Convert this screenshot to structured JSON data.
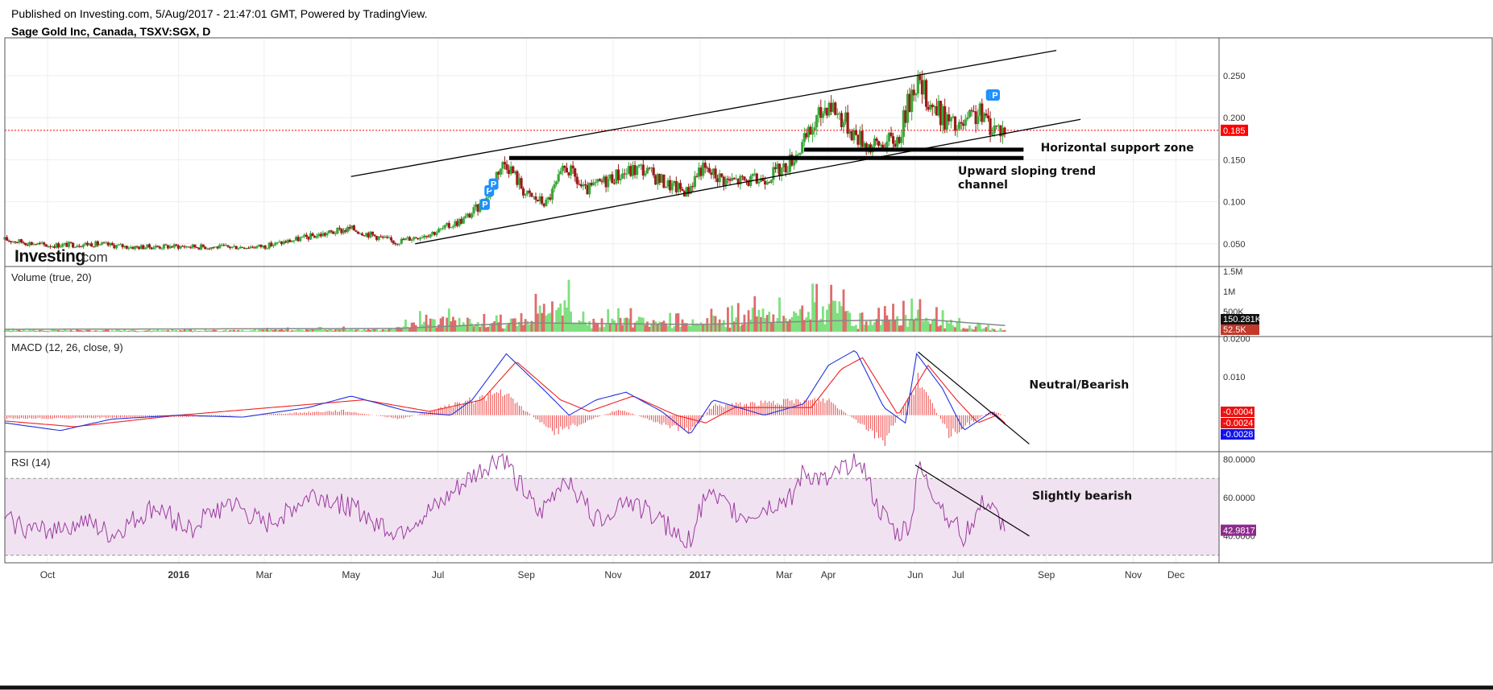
{
  "header": {
    "published": "Published on Investing.com, 5/Aug/2017 - 21:47:01 GMT, Powered by TradingView.",
    "instrument": "Sage Gold Inc, Canada, TSXV:SGX, D"
  },
  "logo": {
    "main": "Investing",
    "suffix": ".com"
  },
  "colors": {
    "up": "#3aa83a",
    "down": "#9c1a1a",
    "vol_up": "#7fe07f",
    "vol_down": "#e06b6b",
    "vol_ma": "#888888",
    "macd": "#2233dd",
    "signal": "#ee2222",
    "hist": "#ee4444",
    "rsi": "#9b3aa0",
    "rsi_band": "#f1e2f1",
    "last_price": "#ff0000",
    "badge": "#1e90ff"
  },
  "chart_data": [
    {
      "type": "candlestick",
      "title": "Sage Gold Inc, Canada, TSXV:SGX, D",
      "x_ticks": [
        {
          "label": "Oct",
          "date": "2015-10-01",
          "bold": false
        },
        {
          "label": "2016",
          "date": "2016-01-01",
          "bold": true
        },
        {
          "label": "Mar",
          "date": "2016-03-01",
          "bold": false
        },
        {
          "label": "May",
          "date": "2016-05-01",
          "bold": false
        },
        {
          "label": "Jul",
          "date": "2016-07-01",
          "bold": false
        },
        {
          "label": "Sep",
          "date": "2016-09-01",
          "bold": false
        },
        {
          "label": "Nov",
          "date": "2016-11-01",
          "bold": false
        },
        {
          "label": "2017",
          "date": "2017-01-01",
          "bold": true
        },
        {
          "label": "Mar",
          "date": "2017-03-01",
          "bold": false
        },
        {
          "label": "Apr",
          "date": "2017-04-01",
          "bold": false
        },
        {
          "label": "Jun",
          "date": "2017-06-01",
          "bold": false
        },
        {
          "label": "Jul",
          "date": "2017-07-01",
          "bold": false
        },
        {
          "label": "Sep",
          "date": "2017-09-01",
          "bold": false
        },
        {
          "label": "Nov",
          "date": "2017-11-01",
          "bold": false
        },
        {
          "label": "Dec",
          "date": "2017-12-01",
          "bold": false
        }
      ],
      "ylim": [
        0.023,
        0.295
      ],
      "y_ticks": [
        "0.050",
        "0.100",
        "0.150",
        "0.200",
        "0.250"
      ],
      "last_price": {
        "value": 0.185,
        "label": "0.185"
      },
      "series": [
        {
          "date": "2015-09-01",
          "close": 0.055
        },
        {
          "date": "2015-10-01",
          "close": 0.048
        },
        {
          "date": "2015-11-01",
          "close": 0.05
        },
        {
          "date": "2015-12-01",
          "close": 0.046
        },
        {
          "date": "2016-01-01",
          "close": 0.047
        },
        {
          "date": "2016-02-01",
          "close": 0.046
        },
        {
          "date": "2016-03-01",
          "close": 0.047
        },
        {
          "date": "2016-04-01",
          "close": 0.058
        },
        {
          "date": "2016-05-01",
          "close": 0.068
        },
        {
          "date": "2016-06-01",
          "close": 0.052
        },
        {
          "date": "2016-07-01",
          "close": 0.065
        },
        {
          "date": "2016-07-20",
          "close": 0.08
        },
        {
          "date": "2016-08-03",
          "close": 0.1
        },
        {
          "date": "2016-08-12",
          "close": 0.138
        },
        {
          "date": "2016-08-18",
          "close": 0.148
        },
        {
          "date": "2016-09-01",
          "close": 0.108
        },
        {
          "date": "2016-09-15",
          "close": 0.098
        },
        {
          "date": "2016-09-29",
          "close": 0.142
        },
        {
          "date": "2016-10-12",
          "close": 0.112
        },
        {
          "date": "2016-11-01",
          "close": 0.13
        },
        {
          "date": "2016-11-20",
          "close": 0.14
        },
        {
          "date": "2016-12-10",
          "close": 0.12
        },
        {
          "date": "2016-12-23",
          "close": 0.112
        },
        {
          "date": "2017-01-01",
          "close": 0.14
        },
        {
          "date": "2017-01-20",
          "close": 0.125
        },
        {
          "date": "2017-02-10",
          "close": 0.125
        },
        {
          "date": "2017-03-01",
          "close": 0.14
        },
        {
          "date": "2017-03-15",
          "close": 0.17
        },
        {
          "date": "2017-04-01",
          "close": 0.22
        },
        {
          "date": "2017-04-20",
          "close": 0.18
        },
        {
          "date": "2017-05-01",
          "close": 0.165
        },
        {
          "date": "2017-05-20",
          "close": 0.175
        },
        {
          "date": "2017-06-01",
          "close": 0.245
        },
        {
          "date": "2017-06-15",
          "close": 0.21
        },
        {
          "date": "2017-07-01",
          "close": 0.185
        },
        {
          "date": "2017-07-15",
          "close": 0.205
        },
        {
          "date": "2017-07-25",
          "close": 0.19
        },
        {
          "date": "2017-08-04",
          "close": 0.185
        }
      ],
      "badges": [
        {
          "label": "P",
          "date": "2016-08-06",
          "y": 0.113
        },
        {
          "label": "P",
          "date": "2016-08-09",
          "y": 0.121
        },
        {
          "label": "P",
          "date": "2016-08-03",
          "y": 0.097
        },
        {
          "label": "I",
          "date": "2017-07-24",
          "y": 0.227
        },
        {
          "label": "P",
          "date": "2017-07-27",
          "y": 0.227
        }
      ],
      "drawings": [
        {
          "kind": "line",
          "width": 1.3,
          "from": {
            "date": "2016-05-01",
            "y": 0.13
          },
          "to": {
            "date": "2017-09-08",
            "y": 0.28
          }
        },
        {
          "kind": "line",
          "width": 1.3,
          "from": {
            "date": "2016-06-15",
            "y": 0.05
          },
          "to": {
            "date": "2017-09-25",
            "y": 0.198
          }
        },
        {
          "kind": "line",
          "width": 5,
          "from": {
            "date": "2016-08-20",
            "y": 0.152
          },
          "to": {
            "date": "2017-08-16",
            "y": 0.152
          }
        },
        {
          "kind": "line",
          "width": 5,
          "from": {
            "date": "2017-03-15",
            "y": 0.162
          },
          "to": {
            "date": "2017-08-16",
            "y": 0.162
          }
        }
      ],
      "annotations": [
        {
          "lines": [
            "Horizontal support zone"
          ],
          "date": "2017-08-28",
          "y": 0.16
        },
        {
          "lines": [
            "Upward sloping trend",
            "channel"
          ],
          "date": "2017-07-01",
          "y": 0.132
        }
      ]
    },
    {
      "type": "bar",
      "title": "Volume (true, 20)",
      "ylim": [
        0,
        1500000
      ],
      "y_ticks": [
        {
          "value": 1500000,
          "label": "1.5M"
        },
        {
          "value": 1000000,
          "label": "1M"
        },
        {
          "value": 500000,
          "label": "500K"
        }
      ],
      "last_values": [
        {
          "label": "150.281K",
          "value": 150281,
          "series": "ma"
        },
        {
          "label": "52.5K",
          "value": 52500,
          "series": "volume"
        }
      ],
      "series": [
        {
          "date": "2015-09-01",
          "value": 80000
        },
        {
          "date": "2016-01-01",
          "value": 60000
        },
        {
          "date": "2016-06-01",
          "value": 150000
        },
        {
          "date": "2016-06-25",
          "value": 650000
        },
        {
          "date": "2016-08-10",
          "value": 400000
        },
        {
          "date": "2016-08-18",
          "value": 450000
        },
        {
          "date": "2016-09-29",
          "value": 1450000
        },
        {
          "date": "2016-10-10",
          "value": 500000
        },
        {
          "date": "2016-11-10",
          "value": 600000
        },
        {
          "date": "2016-12-15",
          "value": 450000
        },
        {
          "date": "2017-01-01",
          "value": 550000
        },
        {
          "date": "2017-01-20",
          "value": 600000
        },
        {
          "date": "2017-02-20",
          "value": 1050000
        },
        {
          "date": "2017-03-05",
          "value": 600000
        },
        {
          "date": "2017-03-10",
          "value": 1000000
        },
        {
          "date": "2017-03-18",
          "value": 1200000
        },
        {
          "date": "2017-04-10",
          "value": 1150000
        },
        {
          "date": "2017-04-22",
          "value": 450000
        },
        {
          "date": "2017-06-01",
          "value": 850000
        },
        {
          "date": "2017-06-05",
          "value": 800000
        },
        {
          "date": "2017-07-01",
          "value": 350000
        },
        {
          "date": "2017-08-04",
          "value": 52500
        }
      ],
      "ma_series": [
        {
          "date": "2015-09-01",
          "value": 60000
        },
        {
          "date": "2016-06-01",
          "value": 80000
        },
        {
          "date": "2016-09-01",
          "value": 220000
        },
        {
          "date": "2017-01-01",
          "value": 180000
        },
        {
          "date": "2017-04-01",
          "value": 270000
        },
        {
          "date": "2017-06-10",
          "value": 300000
        },
        {
          "date": "2017-08-04",
          "value": 150281
        }
      ]
    },
    {
      "type": "line",
      "title": "MACD (12, 26, close, 9)",
      "ylim": [
        -0.0095,
        0.0205
      ],
      "y_ticks": [
        "0.0200",
        "0.010"
      ],
      "last_values": [
        {
          "label": "-0.0004",
          "value": -0.0004,
          "series": "histogram"
        },
        {
          "label": "-0.0024",
          "value": -0.0024,
          "series": "signal"
        },
        {
          "label": "-0.0028",
          "value": -0.0028,
          "series": "macd"
        }
      ],
      "macd": [
        {
          "date": "2015-09-01",
          "value": -0.002
        },
        {
          "date": "2015-10-10",
          "value": -0.004
        },
        {
          "date": "2015-11-15",
          "value": -0.001
        },
        {
          "date": "2016-01-01",
          "value": 0.0
        },
        {
          "date": "2016-02-15",
          "value": -0.0005
        },
        {
          "date": "2016-04-01",
          "value": 0.002
        },
        {
          "date": "2016-05-01",
          "value": 0.005
        },
        {
          "date": "2016-06-10",
          "value": 0.001
        },
        {
          "date": "2016-07-10",
          "value": 0.0
        },
        {
          "date": "2016-07-25",
          "value": 0.004
        },
        {
          "date": "2016-08-18",
          "value": 0.016
        },
        {
          "date": "2016-09-15",
          "value": 0.006
        },
        {
          "date": "2016-10-01",
          "value": 0.0
        },
        {
          "date": "2016-10-20",
          "value": 0.004
        },
        {
          "date": "2016-11-10",
          "value": 0.006
        },
        {
          "date": "2016-12-05",
          "value": 0.001
        },
        {
          "date": "2016-12-25",
          "value": -0.005
        },
        {
          "date": "2017-01-10",
          "value": 0.004
        },
        {
          "date": "2017-02-15",
          "value": 0.0
        },
        {
          "date": "2017-03-15",
          "value": 0.003
        },
        {
          "date": "2017-04-01",
          "value": 0.013
        },
        {
          "date": "2017-04-20",
          "value": 0.017
        },
        {
          "date": "2017-05-10",
          "value": 0.002
        },
        {
          "date": "2017-05-25",
          "value": -0.002
        },
        {
          "date": "2017-06-02",
          "value": 0.016
        },
        {
          "date": "2017-06-20",
          "value": 0.007
        },
        {
          "date": "2017-07-05",
          "value": -0.004
        },
        {
          "date": "2017-07-25",
          "value": 0.001
        },
        {
          "date": "2017-08-04",
          "value": -0.0028
        }
      ],
      "signal": [
        {
          "date": "2015-09-01",
          "value": -0.0015
        },
        {
          "date": "2015-10-20",
          "value": -0.003
        },
        {
          "date": "2016-01-01",
          "value": 0.0
        },
        {
          "date": "2016-05-10",
          "value": 0.004
        },
        {
          "date": "2016-06-25",
          "value": 0.001
        },
        {
          "date": "2016-08-01",
          "value": 0.004
        },
        {
          "date": "2016-08-25",
          "value": 0.014
        },
        {
          "date": "2016-09-25",
          "value": 0.004
        },
        {
          "date": "2016-10-15",
          "value": 0.001
        },
        {
          "date": "2016-11-15",
          "value": 0.005
        },
        {
          "date": "2016-12-15",
          "value": 0.0
        },
        {
          "date": "2017-01-05",
          "value": -0.002
        },
        {
          "date": "2017-01-25",
          "value": 0.002
        },
        {
          "date": "2017-03-20",
          "value": 0.002
        },
        {
          "date": "2017-04-10",
          "value": 0.012
        },
        {
          "date": "2017-04-25",
          "value": 0.015
        },
        {
          "date": "2017-05-20",
          "value": 0.0
        },
        {
          "date": "2017-06-10",
          "value": 0.013
        },
        {
          "date": "2017-06-30",
          "value": 0.004
        },
        {
          "date": "2017-07-15",
          "value": -0.002
        },
        {
          "date": "2017-07-28",
          "value": 0.0
        },
        {
          "date": "2017-08-04",
          "value": -0.0024
        }
      ],
      "histogram": [
        {
          "date": "2015-10-10",
          "value": -0.0008
        },
        {
          "date": "2016-02-01",
          "value": -0.0003
        },
        {
          "date": "2016-04-25",
          "value": 0.0012
        },
        {
          "date": "2016-06-05",
          "value": -0.001
        },
        {
          "date": "2016-08-15",
          "value": 0.006
        },
        {
          "date": "2016-09-20",
          "value": -0.0045
        },
        {
          "date": "2016-11-05",
          "value": 0.0015
        },
        {
          "date": "2016-12-25",
          "value": -0.0045
        },
        {
          "date": "2017-01-10",
          "value": 0.0025
        },
        {
          "date": "2017-04-01",
          "value": 0.004
        },
        {
          "date": "2017-05-10",
          "value": -0.007
        },
        {
          "date": "2017-06-03",
          "value": 0.009
        },
        {
          "date": "2017-06-25",
          "value": -0.005
        },
        {
          "date": "2017-07-25",
          "value": 0.0012
        },
        {
          "date": "2017-08-04",
          "value": -0.0004
        }
      ],
      "drawings": [
        {
          "kind": "line",
          "width": 1.2,
          "from": {
            "date": "2017-06-03",
            "y": 0.0165
          },
          "to": {
            "date": "2017-08-20",
            "y": -0.0075
          }
        }
      ],
      "annotations": [
        {
          "lines": [
            "Neutral/Bearish"
          ],
          "date": "2017-08-20",
          "y": 0.007
        }
      ]
    },
    {
      "type": "line",
      "title": "RSI (14)",
      "ylim": [
        26,
        84
      ],
      "y_ticks": [
        "80.0000",
        "60.0000",
        "40.0000"
      ],
      "bands": {
        "upper": 70,
        "lower": 30
      },
      "last_value": {
        "label": "42.9817",
        "value": 42.9817
      },
      "series": [
        {
          "date": "2015-09-01",
          "value": 48
        },
        {
          "date": "2015-09-25",
          "value": 42
        },
        {
          "date": "2015-10-25",
          "value": 48
        },
        {
          "date": "2015-11-15",
          "value": 40
        },
        {
          "date": "2015-12-15",
          "value": 55
        },
        {
          "date": "2016-01-10",
          "value": 44
        },
        {
          "date": "2016-02-05",
          "value": 58
        },
        {
          "date": "2016-03-01",
          "value": 45
        },
        {
          "date": "2016-04-05",
          "value": 62
        },
        {
          "date": "2016-05-01",
          "value": 55
        },
        {
          "date": "2016-06-01",
          "value": 42
        },
        {
          "date": "2016-07-01",
          "value": 55
        },
        {
          "date": "2016-07-20",
          "value": 68
        },
        {
          "date": "2016-08-15",
          "value": 82
        },
        {
          "date": "2016-09-10",
          "value": 50
        },
        {
          "date": "2016-09-29",
          "value": 72
        },
        {
          "date": "2016-10-20",
          "value": 48
        },
        {
          "date": "2016-11-10",
          "value": 60
        },
        {
          "date": "2016-12-05",
          "value": 48
        },
        {
          "date": "2016-12-23",
          "value": 35
        },
        {
          "date": "2017-01-05",
          "value": 62
        },
        {
          "date": "2017-02-01",
          "value": 50
        },
        {
          "date": "2017-03-05",
          "value": 60
        },
        {
          "date": "2017-03-15",
          "value": 73
        },
        {
          "date": "2017-04-01",
          "value": 67
        },
        {
          "date": "2017-04-22",
          "value": 83
        },
        {
          "date": "2017-05-05",
          "value": 55
        },
        {
          "date": "2017-05-20",
          "value": 40
        },
        {
          "date": "2017-05-30",
          "value": 48
        },
        {
          "date": "2017-06-02",
          "value": 76
        },
        {
          "date": "2017-06-20",
          "value": 55
        },
        {
          "date": "2017-07-05",
          "value": 40
        },
        {
          "date": "2017-07-20",
          "value": 58
        },
        {
          "date": "2017-08-04",
          "value": 42.9817
        }
      ],
      "drawings": [
        {
          "kind": "line",
          "width": 1.2,
          "from": {
            "date": "2017-06-01",
            "y": 77
          },
          "to": {
            "date": "2017-08-20",
            "y": 40
          }
        }
      ],
      "annotations": [
        {
          "lines": [
            "Slightly bearish"
          ],
          "date": "2017-08-22",
          "y": 59
        }
      ]
    }
  ]
}
